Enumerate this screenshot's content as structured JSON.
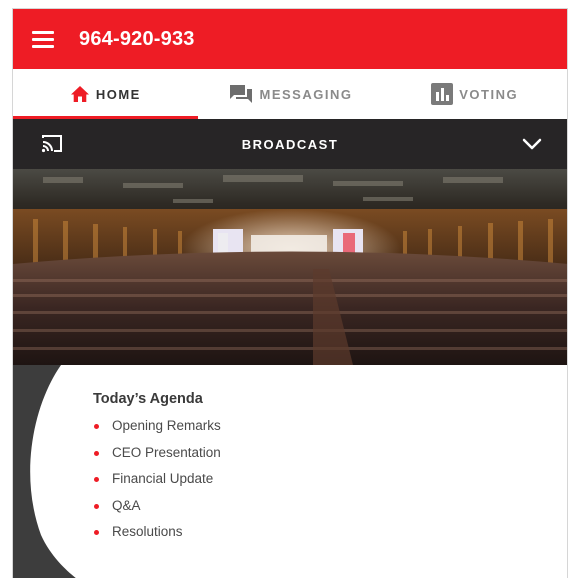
{
  "header": {
    "title": "964-920-933",
    "menu_icon": "hamburger-menu-icon",
    "background_color": "#ee1c25"
  },
  "tabs": [
    {
      "label": "HOME",
      "icon": "home-icon",
      "active": true
    },
    {
      "label": "MESSAGING",
      "icon": "chat-icon",
      "active": false
    },
    {
      "label": "VOTING",
      "icon": "bar-chart-icon",
      "active": false
    }
  ],
  "broadcast": {
    "label": "BROADCAST",
    "left_icon": "cast-icon",
    "right_icon": "chevron-down-icon",
    "bar_color": "#272526"
  },
  "agenda": {
    "title": "Today’s Agenda",
    "items": [
      "Opening Remarks",
      "CEO Presentation",
      "Financial Update",
      "Q&A",
      "Resolutions"
    ],
    "bullet_color": "#ee1c25"
  }
}
